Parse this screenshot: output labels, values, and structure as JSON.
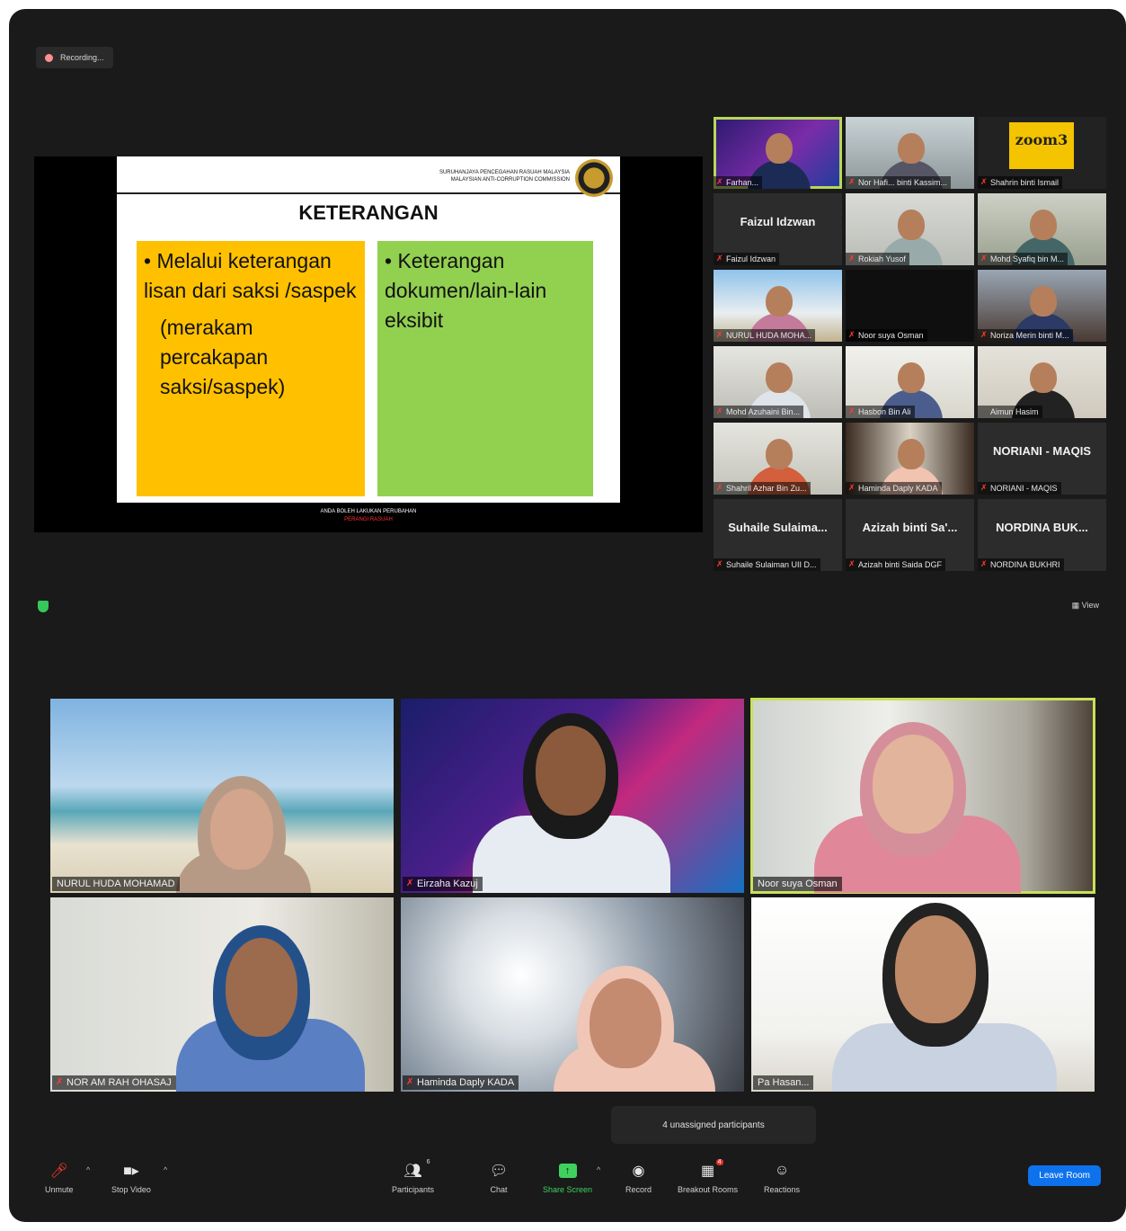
{
  "recording": {
    "label": "Recording..."
  },
  "slide": {
    "org_line1": "SURUHANJAYA PENCEGAHAN RASUAH MALAYSIA",
    "org_line2": "MALAYSIAN ANTI-CORRUPTION COMMISSION",
    "title": "KETERANGAN",
    "left_bullet": "• Melalui keterangan lisan dari saksi /saspek",
    "left_sub": "(merakam percakapan saksi/saspek)",
    "right_bullet": "• Keterangan dokumen/lain-lain eksibit",
    "footer_line1": "ANDA BOLEH LAKUKAN PERUBAHAN",
    "footer_line2": "PERANGI RASUAH"
  },
  "gallery": [
    {
      "name": "Farhan...",
      "active": true
    },
    {
      "name": "Nor Hafi... binti Kassim..."
    },
    {
      "name": "Shahrin binti Ismail",
      "logo": "zoom3"
    },
    {
      "name": "Faizul Idzwan",
      "big": "Faizul Idzwan"
    },
    {
      "name": "Rokiah Yusof"
    },
    {
      "name": "Mohd Syafiq bin M..."
    },
    {
      "name": "NURUL HUDA MOHA..."
    },
    {
      "name": "Noor suya Osman"
    },
    {
      "name": "Noriza Merin binti M..."
    },
    {
      "name": "Mohd Azuhaini Bin..."
    },
    {
      "name": "Hasbon Bin Ali"
    },
    {
      "name": "Aimun Hasim",
      "nomic": true
    },
    {
      "name": "Shahril Azhar Bin Zu..."
    },
    {
      "name": "Haminda Daply KADA"
    },
    {
      "name": "NORIANI - MAQIS",
      "big": "NORIANI - MAQIS"
    },
    {
      "name": "Suhaile Sulaiman UII D...",
      "big": "Suhaile Sulaima..."
    },
    {
      "name": "Azizah binti Saida DGF",
      "big": "Azizah binti Sa'..."
    },
    {
      "name": "NORDINA BUKHRI",
      "big": "NORDINA BUK..."
    }
  ],
  "shield_icon": "shield-icon",
  "view_label": "View",
  "videos": [
    {
      "name": "NURUL HUDA MOHAMAD",
      "nomic": true
    },
    {
      "name": "Eirzaha Kazuj"
    },
    {
      "name": "Noor suya Osman",
      "nomic": true,
      "active": true
    },
    {
      "name": "NOR AM RAH OHASAJ"
    },
    {
      "name": "Haminda Daply KADA"
    },
    {
      "name": "Pa Hasan...",
      "nomic": true
    }
  ],
  "toast": "4 unassigned participants",
  "toolbar": {
    "unmute": "Unmute",
    "stop_video": "Stop Video",
    "participants": "Participants",
    "participants_count": "6",
    "chat": "Chat",
    "share_screen": "Share Screen",
    "record": "Record",
    "breakout": "Breakout Rooms",
    "breakout_badge": "4",
    "reactions": "Reactions",
    "leave": "Leave Room"
  },
  "colors": {
    "accent_green": "#3fd15e",
    "leave_blue": "#0e72ed",
    "active_outline": "#c8e05a",
    "muted_red": "#ff3b30"
  }
}
